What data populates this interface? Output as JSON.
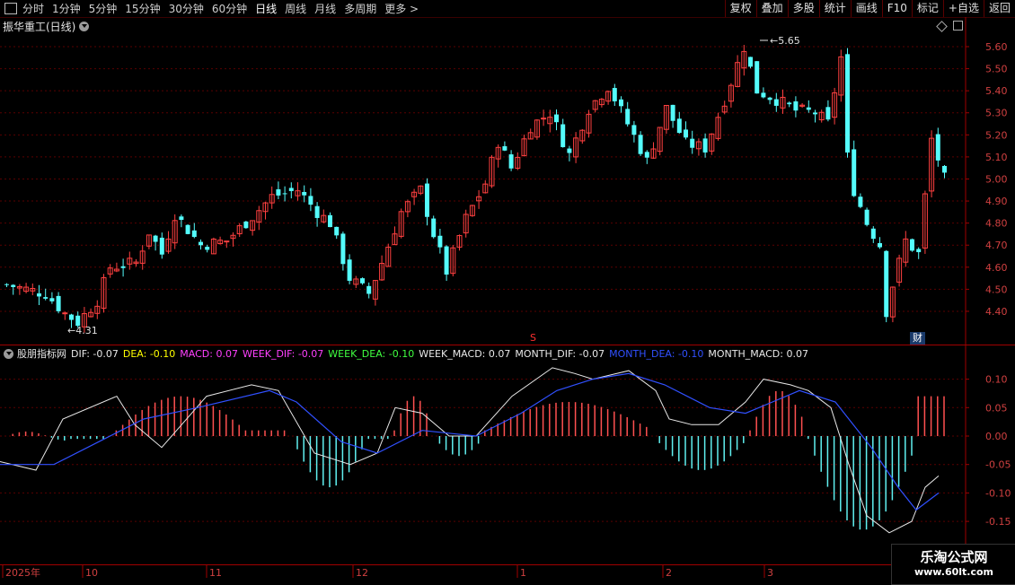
{
  "toolbar": {
    "periods": [
      "分时",
      "1分钟",
      "5分钟",
      "15分钟",
      "30分钟",
      "60分钟",
      "日线",
      "周线",
      "月线",
      "多周期",
      "更多 >"
    ],
    "active_period": "日线",
    "right_tools": [
      "复权",
      "叠加",
      "多股",
      "统计",
      "画线",
      "F10",
      "标记",
      "+自选",
      "返回"
    ]
  },
  "stock": {
    "title": "振华重工(日线)"
  },
  "price_panel": {
    "y_ticks": [
      "5.60",
      "5.50",
      "5.40",
      "5.30",
      "5.20",
      "5.10",
      "5.00",
      "4.90",
      "4.80",
      "4.70",
      "4.60",
      "4.50",
      "4.40"
    ],
    "high_label": "5.65",
    "low_label": "4.31",
    "s_marker": "S",
    "cai_badge": "财",
    "colors": {
      "up": "#ff4040",
      "down": "#54fcfc"
    }
  },
  "indicator": {
    "name": "股朋指标网",
    "items": [
      {
        "label": "DIF: -0.07",
        "color": "#e8e8e8"
      },
      {
        "label": "DEA: -0.10",
        "color": "#ffff00"
      },
      {
        "label": "MACD: 0.07",
        "color": "#ff40ff"
      },
      {
        "label": "WEEK_DIF: -0.07",
        "color": "#ff40ff"
      },
      {
        "label": "WEEK_DEA: -0.10",
        "color": "#40ff40"
      },
      {
        "label": "WEEK_MACD: 0.07",
        "color": "#e8e8e8"
      },
      {
        "label": "MONTH_DIF: -0.07",
        "color": "#e8e8e8"
      },
      {
        "label": "MONTH_DEA: -0.10",
        "color": "#3050ff"
      },
      {
        "label": "MONTH_MACD: 0.07",
        "color": "#e8e8e8"
      }
    ],
    "y_ticks": [
      "0.10",
      "0.05",
      "0.00",
      "-0.05",
      "-0.10",
      "-0.15"
    ]
  },
  "time_axis": {
    "labels": [
      "2025年",
      "10",
      "11",
      "12",
      "1",
      "2",
      "3"
    ]
  },
  "watermark": {
    "line1": "乐淘公式网",
    "line2": "www.60lt.com"
  }
}
